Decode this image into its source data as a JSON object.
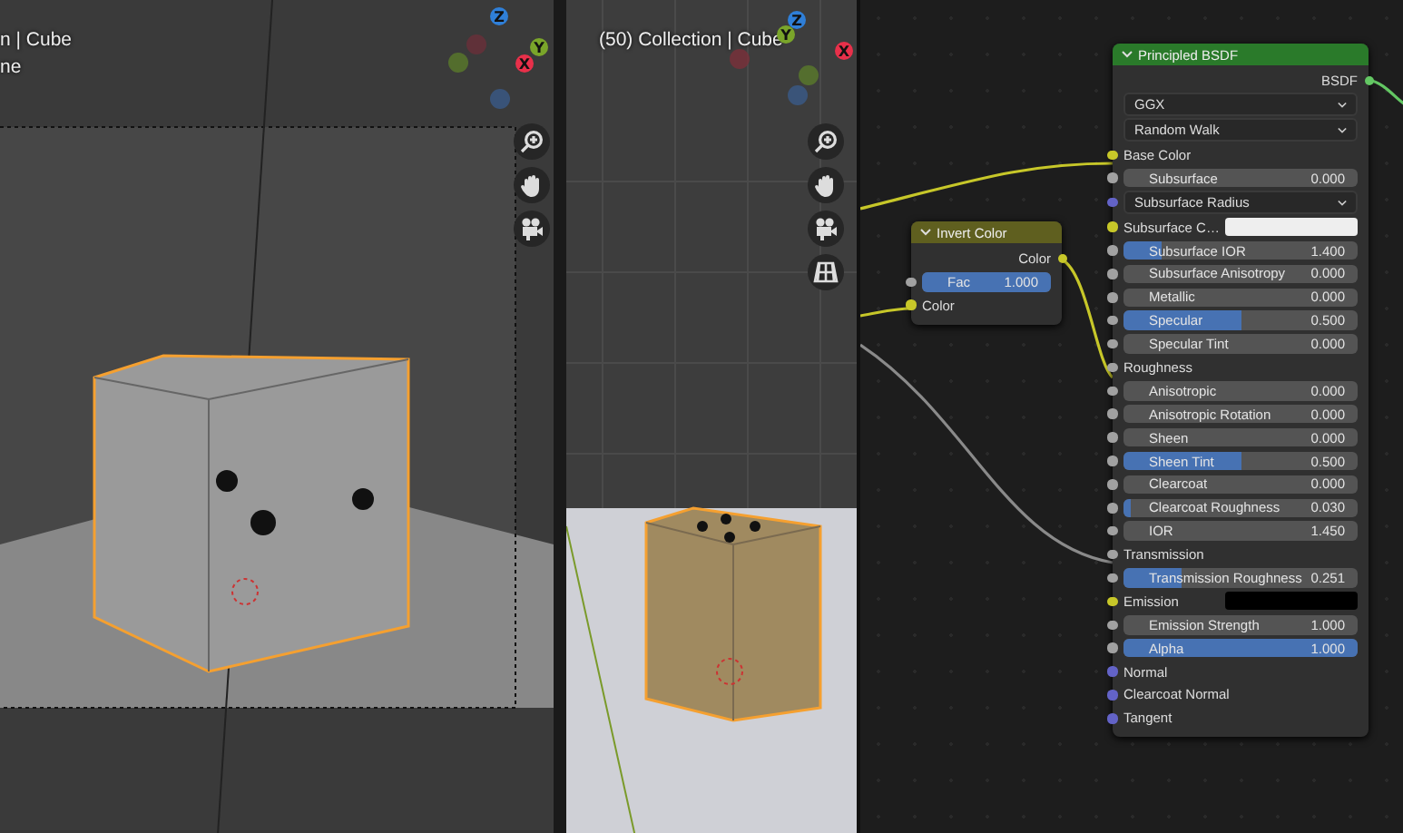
{
  "viewports": [
    {
      "info_lines": [
        "n | Cube",
        "ne"
      ],
      "gizmo": [
        "Z",
        "Y",
        "X"
      ],
      "tools": [
        {
          "kind": "zoom"
        },
        {
          "kind": "pan"
        },
        {
          "kind": "camera"
        }
      ],
      "kind": "camera-view"
    },
    {
      "info_lines": [
        "(50) Collection | Cube"
      ],
      "gizmo": [
        "Z",
        "Y",
        "X"
      ],
      "tools": [
        {
          "kind": "zoom"
        },
        {
          "kind": "pan"
        },
        {
          "kind": "camera"
        },
        {
          "kind": "grid"
        }
      ],
      "kind": "perspective"
    }
  ],
  "nodes": [
    {
      "title": "Invert Color",
      "kind": "converter",
      "rows": [
        {
          "kind": "output",
          "label": "Color",
          "color": "#c7c729"
        },
        {
          "kind": "slider",
          "label": "Fac",
          "value": "1.000",
          "level": 1,
          "color": "#a1a1a1"
        },
        {
          "kind": "input",
          "label": "Color",
          "color": "#c7c729"
        }
      ]
    },
    {
      "title": "Principled BSDF",
      "kind": "shader",
      "rows": [
        {
          "kind": "output",
          "label": "BSDF",
          "color": "#63c763"
        },
        {
          "kind": "dropdown",
          "label": "GGX"
        },
        {
          "kind": "dropdown",
          "label": "Random Walk"
        },
        {
          "kind": "input",
          "label": "Base Color",
          "color": "#c7c729"
        },
        {
          "kind": "slider",
          "label": "Subsurface",
          "value": "0.000",
          "level": 0,
          "color": "#a1a1a1"
        },
        {
          "kind": "dropdown",
          "label": "Subsurface Radius",
          "color": "#6363c7"
        },
        {
          "kind": "swatch",
          "label": "Subsurface C…",
          "swatch": {
            "color": "#eeeeee"
          },
          "color": "#c7c729"
        },
        {
          "kind": "slider",
          "label": "Subsurface IOR",
          "value": "1.400",
          "level": 0.16,
          "color": "#a1a1a1"
        },
        {
          "kind": "slider",
          "label": "Subsurface Anisotropy",
          "value": "0.000",
          "level": 0,
          "color": "#a1a1a1"
        },
        {
          "kind": "slider",
          "label": "Metallic",
          "value": "0.000",
          "level": 0,
          "color": "#a1a1a1"
        },
        {
          "kind": "slider",
          "label": "Specular",
          "value": "0.500",
          "level": 0.5,
          "color": "#a1a1a1"
        },
        {
          "kind": "slider",
          "label": "Specular Tint",
          "value": "0.000",
          "level": 0,
          "color": "#a1a1a1"
        },
        {
          "kind": "input",
          "label": "Roughness",
          "color": "#a1a1a1"
        },
        {
          "kind": "slider",
          "label": "Anisotropic",
          "value": "0.000",
          "level": 0,
          "color": "#a1a1a1"
        },
        {
          "kind": "slider",
          "label": "Anisotropic Rotation",
          "value": "0.000",
          "level": 0,
          "color": "#a1a1a1"
        },
        {
          "kind": "slider",
          "label": "Sheen",
          "value": "0.000",
          "level": 0,
          "color": "#a1a1a1"
        },
        {
          "kind": "slider",
          "label": "Sheen Tint",
          "value": "0.500",
          "level": 0.5,
          "color": "#a1a1a1"
        },
        {
          "kind": "slider",
          "label": "Clearcoat",
          "value": "0.000",
          "level": 0,
          "color": "#a1a1a1"
        },
        {
          "kind": "slider",
          "label": "Clearcoat Roughness",
          "value": "0.030",
          "level": 0.03,
          "color": "#a1a1a1"
        },
        {
          "kind": "slider",
          "label": "IOR",
          "value": "1.450",
          "level": 0,
          "color": "#a1a1a1"
        },
        {
          "kind": "input",
          "label": "Transmission",
          "color": "#a1a1a1"
        },
        {
          "kind": "slider",
          "label": "Transmission Roughness",
          "value": "0.251",
          "level": 0.251,
          "color": "#a1a1a1"
        },
        {
          "kind": "swatch",
          "label": "Emission",
          "swatch": {
            "color": "#000000"
          },
          "color": "#c7c729"
        },
        {
          "kind": "slider",
          "label": "Emission Strength",
          "value": "1.000",
          "level": 0,
          "color": "#a1a1a1"
        },
        {
          "kind": "slider",
          "label": "Alpha",
          "value": "1.000",
          "level": 1,
          "color": "#a1a1a1"
        },
        {
          "kind": "input",
          "label": "Normal",
          "color": "#6363c7"
        },
        {
          "kind": "input",
          "label": "Clearcoat Normal",
          "color": "#6363c7"
        },
        {
          "kind": "input",
          "label": "Tangent",
          "color": "#6363c7"
        }
      ]
    }
  ]
}
